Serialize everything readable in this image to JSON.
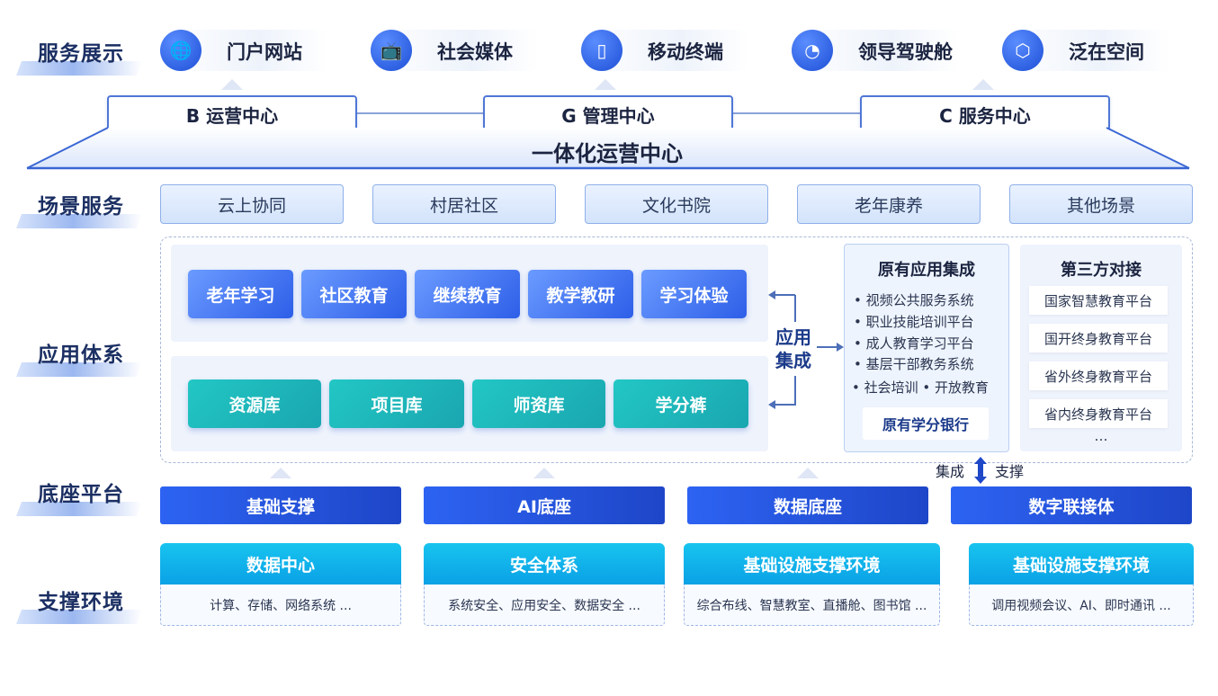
{
  "row_labels": {
    "service": "服务展示",
    "scene": "场景服务",
    "app": "应用体系",
    "platform": "底座平台",
    "env": "支撑环境"
  },
  "services": [
    {
      "label": "门户网站",
      "icon": "globe-icon",
      "glyph": "🌐"
    },
    {
      "label": "社会媒体",
      "icon": "tv-icon",
      "glyph": "📺"
    },
    {
      "label": "移动终端",
      "icon": "phone-icon",
      "glyph": "▯"
    },
    {
      "label": "领导驾驶舱",
      "icon": "dashboard-icon",
      "glyph": "◔"
    },
    {
      "label": "泛在空间",
      "icon": "cube-icon",
      "glyph": "⬡"
    }
  ],
  "centers": {
    "b": "B 运营中心",
    "g": "G 管理中心",
    "c": "C 服务中心",
    "integrated": "一体化运营中心"
  },
  "scenes": [
    "云上协同",
    "村居社区",
    "文化书院",
    "老年康养",
    "其他场景"
  ],
  "apps_top": [
    "老年学习",
    "社区教育",
    "继续教育",
    "教学教研",
    "学习体验"
  ],
  "apps_bottom": [
    "资源库",
    "项目库",
    "师资库",
    "学分裤"
  ],
  "integration_label": "应用\n集成",
  "integration_line1": "应用",
  "integration_line2": "集成",
  "original_apps": {
    "title": "原有应用集成",
    "items": [
      "• 视频公共服务系统",
      "• 职业技能培训平台",
      "• 成人教育学习平台",
      "• 基层干部教务系统",
      "• 社会培训 • 开放教育"
    ],
    "bank": "原有学分银行"
  },
  "third_party": {
    "title": "第三方对接",
    "items": [
      "国家智慧教育平台",
      "国开终身教育平台",
      "省外终身教育平台",
      "省内终身教育平台"
    ],
    "more": "…"
  },
  "integrate_support": {
    "left": "集成",
    "right": "支撑"
  },
  "platforms": [
    "基础支撑",
    "AI底座",
    "数据底座",
    "数字联接体"
  ],
  "env": [
    {
      "title": "数据中心",
      "desc": "计算、存储、网络系统 ..."
    },
    {
      "title": "安全体系",
      "desc": "系统安全、应用安全、数据安全 ..."
    },
    {
      "title": "基础设施支撑环境",
      "desc": "综合布线、智慧教室、直播舱、图书馆 ..."
    },
    {
      "title": "基础设施支撑环境",
      "desc": "调用视频会议、AI、即时通讯 ..."
    }
  ]
}
